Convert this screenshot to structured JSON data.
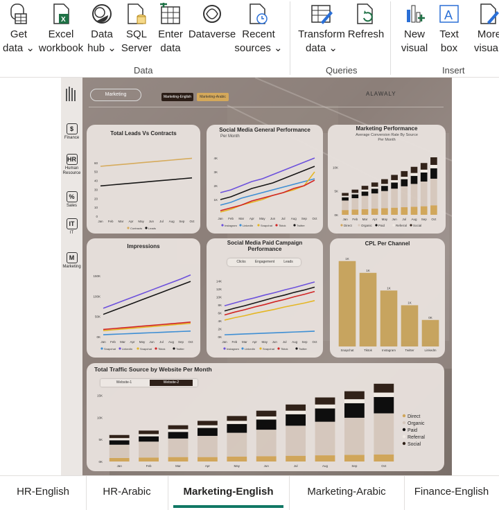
{
  "ribbon": {
    "buttons": [
      {
        "line1": "Get",
        "line2": "data",
        "chev": true,
        "icon": "database-table-icon"
      },
      {
        "line1": "Excel",
        "line2": "workbook",
        "chev": false,
        "icon": "excel-icon"
      },
      {
        "line1": "Data",
        "line2": "hub",
        "chev": true,
        "icon": "data-hub-icon"
      },
      {
        "line1": "SQL",
        "line2": "Server",
        "chev": false,
        "icon": "sql-server-icon"
      },
      {
        "line1": "Enter",
        "line2": "data",
        "chev": false,
        "icon": "enter-data-icon"
      },
      {
        "line1": "Dataverse",
        "line2": "",
        "chev": false,
        "icon": "dataverse-icon"
      },
      {
        "line1": "Recent",
        "line2": "sources",
        "chev": true,
        "icon": "recent-sources-icon"
      },
      {
        "line1": "Transform",
        "line2": "data",
        "chev": true,
        "icon": "transform-data-icon"
      },
      {
        "line1": "Refresh",
        "line2": "",
        "chev": false,
        "icon": "refresh-icon"
      },
      {
        "line1": "New",
        "line2": "visual",
        "chev": false,
        "icon": "new-visual-icon"
      },
      {
        "line1": "Text",
        "line2": "box",
        "chev": false,
        "icon": "text-box-icon"
      },
      {
        "line1": "More",
        "line2": "visuals",
        "chev": false,
        "icon": "more-visuals-icon"
      }
    ],
    "groups": {
      "data": "Data",
      "queries": "Queries",
      "insert": "Insert"
    }
  },
  "report": {
    "page_pill": "Marketing",
    "lang_en": "Marketing-English",
    "lang_ar": "Marketing-Arabic",
    "brand": "ALAWALY",
    "sidebar": [
      "Finance",
      "Human Resource",
      "Sales",
      "IT",
      "Marketing"
    ],
    "sidebar_icons": [
      "$",
      "HR",
      "%",
      "IT",
      "M"
    ]
  },
  "chart_data": [
    {
      "type": "line",
      "title": "Total Leads Vs Contracts",
      "categories": [
        "Jan",
        "Feb",
        "Mar",
        "Apr",
        "May",
        "Jun",
        "Jul",
        "Aug",
        "Sep",
        "Oct"
      ],
      "yticks": [
        "0",
        "10",
        "20",
        "30",
        "40",
        "50",
        "60"
      ],
      "ylim": [
        0,
        70
      ],
      "series": [
        {
          "name": "Contracts",
          "color": "#d9ad5b",
          "values": [
            56,
            57,
            58,
            59,
            60,
            61,
            62,
            63,
            64,
            65
          ]
        },
        {
          "name": "Leads",
          "color": "#111111",
          "values": [
            34,
            35,
            36,
            37,
            38,
            39,
            40,
            41,
            42,
            43
          ]
        }
      ]
    },
    {
      "type": "line",
      "title": "Social Media General Performance",
      "subtitle": "Per Month",
      "categories": [
        "Jan",
        "Feb",
        "Mar",
        "Apr",
        "May",
        "Jun",
        "Jul",
        "Aug",
        "Sep",
        "Oct"
      ],
      "yticks": [
        "1K",
        "2K",
        "3K",
        "4K"
      ],
      "ylim": [
        0.5,
        4.5
      ],
      "series": [
        {
          "name": "Instagram",
          "color": "#6b4fe0",
          "values": [
            2.0,
            2.2,
            2.5,
            2.8,
            3.0,
            3.3,
            3.6,
            3.9,
            4.2,
            4.5
          ]
        },
        {
          "name": "LinkedIn",
          "color": "#3a8fd8",
          "values": [
            1.1,
            1.3,
            1.6,
            1.8,
            2.0,
            2.2,
            2.4,
            2.6,
            2.8,
            3.0
          ]
        },
        {
          "name": "Snapchat",
          "color": "#e8b820",
          "values": [
            0.6,
            0.8,
            1.1,
            1.3,
            1.5,
            1.8,
            2.0,
            2.2,
            2.5,
            3.5
          ]
        },
        {
          "name": "Tiktok",
          "color": "#d42020",
          "values": [
            0.7,
            0.9,
            1.1,
            1.4,
            1.6,
            1.8,
            2.0,
            2.3,
            2.5,
            2.9
          ]
        },
        {
          "name": "Twitter",
          "color": "#111111",
          "values": [
            1.5,
            1.7,
            2.0,
            2.3,
            2.5,
            2.7,
            3.0,
            3.3,
            3.6,
            3.9
          ]
        }
      ]
    },
    {
      "type": "bar",
      "title": "Marketing Performance",
      "subtitle": "Average Conversion Rate By Source",
      "subtitle2": "Per Month",
      "categories": [
        "Jan",
        "Feb",
        "Mar",
        "Apr",
        "May",
        "Jun",
        "Jul",
        "Aug",
        "Sep",
        "Oct"
      ],
      "yticks": [
        "0K",
        "5K",
        "10K"
      ],
      "ylim": [
        0,
        14
      ],
      "series": [
        {
          "name": "Direct",
          "color": "#d4a85a",
          "values": [
            1.0,
            1.1,
            1.2,
            1.3,
            1.4,
            1.5,
            1.6,
            1.7,
            1.8,
            2.0
          ]
        },
        {
          "name": "Organic",
          "color": "#d9cbc0",
          "values": [
            2.0,
            2.4,
            2.8,
            3.2,
            3.6,
            4.0,
            4.4,
            4.8,
            5.2,
            5.6
          ]
        },
        {
          "name": "Paid",
          "color": "#0a0a0a",
          "values": [
            0.7,
            0.8,
            0.9,
            1.0,
            1.1,
            1.3,
            1.5,
            1.7,
            1.9,
            2.2
          ]
        },
        {
          "name": "Referral",
          "color": "#f5efe8",
          "values": [
            0.3,
            0.3,
            0.4,
            0.4,
            0.4,
            0.5,
            0.5,
            0.6,
            0.6,
            0.7
          ]
        },
        {
          "name": "Social",
          "color": "#2e1f16",
          "values": [
            0.6,
            0.7,
            0.8,
            0.9,
            1.0,
            1.1,
            1.2,
            1.3,
            1.4,
            1.6
          ]
        }
      ]
    },
    {
      "type": "line",
      "title": "Impressions",
      "categories": [
        "Jan",
        "Feb",
        "Mar",
        "Apr",
        "May",
        "Jun",
        "Jul",
        "Aug",
        "Sep",
        "Oct"
      ],
      "yticks": [
        "0K",
        "50K",
        "100K",
        "150K"
      ],
      "ylim": [
        0,
        160
      ],
      "series": [
        {
          "name": "Snapchat",
          "color": "#3a8fd8",
          "values": [
            5,
            6,
            7,
            8,
            9,
            10,
            11,
            12,
            13,
            14
          ]
        },
        {
          "name": "LinkedIn",
          "color": "#6b4fe0",
          "values": [
            70,
            79,
            88,
            97,
            106,
            115,
            124,
            133,
            142,
            152
          ]
        },
        {
          "name": "Snapchat",
          "color": "#e8b820",
          "values": [
            15,
            17,
            19,
            21,
            23,
            25,
            27,
            29,
            31,
            33
          ]
        },
        {
          "name": "Tiktok",
          "color": "#d42020",
          "values": [
            18,
            20,
            22,
            24,
            26,
            28,
            30,
            32,
            34,
            36
          ]
        },
        {
          "name": "Twitter",
          "color": "#111111",
          "values": [
            55,
            64,
            73,
            82,
            91,
            100,
            109,
            118,
            127,
            136
          ]
        }
      ]
    },
    {
      "type": "line",
      "title": "Social Media Paid Campaign",
      "title2": "Performance",
      "buttons": [
        "Clicks",
        "Engagement",
        "Leads"
      ],
      "categories": [
        "Jan",
        "Feb",
        "Mar",
        "Apr",
        "May",
        "Jun",
        "Jul",
        "Aug",
        "Sep",
        "Oct"
      ],
      "yticks": [
        "0K",
        "2K",
        "4K",
        "6K",
        "8K",
        "10K",
        "12K",
        "14K"
      ],
      "ylim": [
        0,
        15
      ],
      "series": [
        {
          "name": "Instagram",
          "color": "#6b4fe0",
          "values": [
            7.8,
            8.5,
            9.2,
            9.8,
            10.5,
            11.1,
            11.8,
            12.4,
            13.1,
            13.8
          ]
        },
        {
          "name": "LinkedIn",
          "color": "#3a8fd8",
          "values": [
            0.5,
            0.6,
            0.7,
            0.8,
            0.9,
            1.0,
            1.1,
            1.2,
            1.3,
            1.4
          ]
        },
        {
          "name": "Snapchat",
          "color": "#e8b820",
          "values": [
            4.2,
            4.8,
            5.3,
            5.9,
            6.4,
            6.9,
            7.5,
            8.0,
            8.5,
            9.1
          ]
        },
        {
          "name": "Tiktok",
          "color": "#d42020",
          "values": [
            5.5,
            6.2,
            6.8,
            7.5,
            8.1,
            8.8,
            9.4,
            10.1,
            10.7,
            11.4
          ]
        },
        {
          "name": "Twitter",
          "color": "#111111",
          "values": [
            6.5,
            7.2,
            7.8,
            8.5,
            9.2,
            9.9,
            10.5,
            11.2,
            11.8,
            12.5
          ]
        }
      ]
    },
    {
      "type": "bar",
      "title": "CPL Per Channel",
      "categories": [
        "Snapchat",
        "Tiktok",
        "Instagram",
        "Twitter",
        "LinkedIn"
      ],
      "values": [
        1.45,
        1.25,
        0.95,
        0.7,
        0.45
      ],
      "labels": [
        "1K",
        "1K",
        "1K",
        "1K",
        "0K"
      ],
      "color": "#c9a55e",
      "ylim": [
        0,
        1.6
      ]
    },
    {
      "type": "bar",
      "title": "Total Traffic Source by Website Per Month",
      "buttons": [
        "Website-1",
        "Website-2"
      ],
      "categories": [
        "Jan",
        "Feb",
        "Mar",
        "Apr",
        "May",
        "Jun",
        "Jul",
        "Aug",
        "Sep",
        "Oct"
      ],
      "yticks": [
        "0K",
        "5K",
        "10K",
        "15K"
      ],
      "ylim": [
        0,
        16
      ],
      "series": [
        {
          "name": "Direct",
          "color": "#d4a85a",
          "values": [
            0.8,
            0.9,
            1.0,
            1.0,
            1.1,
            1.2,
            1.3,
            1.4,
            1.5,
            1.6
          ]
        },
        {
          "name": "Organic",
          "color": "#d9cbc0",
          "values": [
            3.0,
            3.6,
            4.2,
            4.8,
            5.4,
            6.0,
            6.8,
            7.6,
            8.4,
            9.3
          ]
        },
        {
          "name": "Paid",
          "color": "#0a0a0a",
          "values": [
            1.0,
            1.2,
            1.5,
            1.8,
            2.0,
            2.3,
            2.6,
            3.0,
            3.3,
            3.7
          ]
        },
        {
          "name": "Referral",
          "color": "#f5efe8",
          "values": [
            0.5,
            0.5,
            0.6,
            0.6,
            0.7,
            0.7,
            0.8,
            0.9,
            0.9,
            1.0
          ]
        },
        {
          "name": "Social",
          "color": "#2e1f16",
          "values": [
            0.7,
            0.8,
            0.9,
            1.0,
            1.1,
            1.3,
            1.4,
            1.6,
            1.8,
            2.0
          ]
        }
      ]
    }
  ],
  "tabs": [
    {
      "label": "HR-English",
      "active": false
    },
    {
      "label": "HR-Arabic",
      "active": false
    },
    {
      "label": "Marketing-English",
      "active": true
    },
    {
      "label": "Marketing-Arabic",
      "active": false
    },
    {
      "label": "Finance-English",
      "active": false
    }
  ]
}
